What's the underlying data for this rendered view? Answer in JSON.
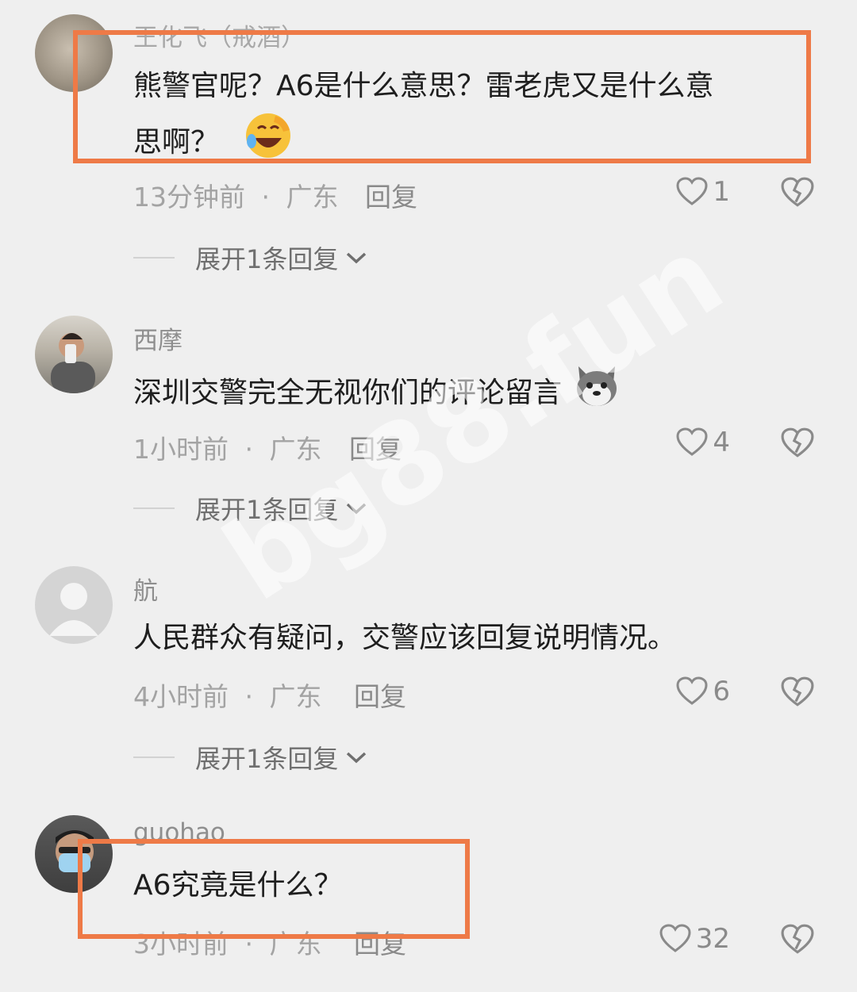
{
  "comments": [
    {
      "username": "王化飞（戒酒）",
      "text_line1": "熊警官呢？A6是什么意思？雷老虎又是什么意",
      "text_line2": "思啊？",
      "emoji": "laughing-crying-emoji",
      "time": "13分钟前",
      "location": "广东",
      "reply_label": "回复",
      "likes": "1",
      "expand_label": "展开1条回复"
    },
    {
      "username": "西摩",
      "text": "深圳交警完全无视你们的评论留言",
      "emoji": "husky-dog-emoji",
      "time": "1小时前",
      "location": "广东",
      "reply_label": "回复",
      "likes": "4",
      "expand_label": "展开1条回复"
    },
    {
      "username": "航",
      "text": "人民群众有疑问，交警应该回复说明情况。",
      "time": "4小时前",
      "location": "广东",
      "reply_label": "回复",
      "likes": "6",
      "expand_label": "展开1条回复"
    },
    {
      "username": "guohao",
      "text": "A6究竟是什么？",
      "time": "3小时前",
      "location": "广东",
      "reply_label": "回复",
      "likes": "32"
    }
  ],
  "separator": "·",
  "watermark": "bg88.fun",
  "colors": {
    "highlight": "#ee7a47",
    "background": "#efefef"
  },
  "icons": [
    "heart-outline-icon",
    "broken-heart-icon",
    "chevron-down-icon"
  ]
}
